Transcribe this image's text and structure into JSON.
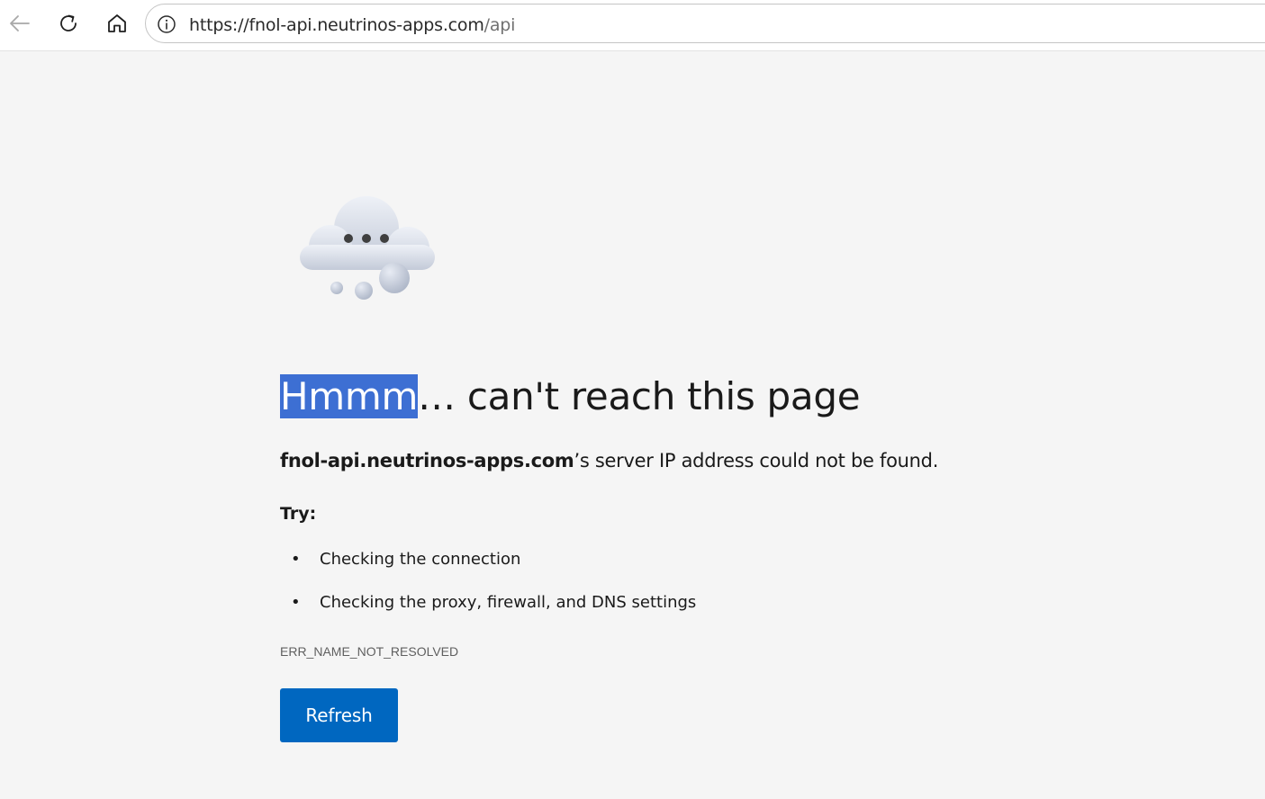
{
  "browser": {
    "url_origin": "https://fnol-api.neutrinos-apps.com",
    "url_path": "/api",
    "icons": {
      "back": "back-arrow-icon",
      "reload": "reload-icon",
      "home": "home-icon",
      "site_info": "info-icon"
    }
  },
  "error_page": {
    "illustration": "thinking-cloud-icon",
    "heading_selected": "Hmmm",
    "heading_rest": "… can't reach this page",
    "summary_host": "fnol-api.neutrinos-apps.com",
    "summary_rest": "’s server IP address could not be found.",
    "try_label": "Try:",
    "suggestions": [
      "Checking the connection",
      "Checking the proxy, firewall, and DNS settings"
    ],
    "error_code": "ERR_NAME_NOT_RESOLVED",
    "refresh_label": "Refresh"
  },
  "colors": {
    "page_background": "#f5f5f5",
    "selection_highlight": "#3d6fd3",
    "button_primary": "#0067c0",
    "text_primary": "#1a1a1a"
  }
}
